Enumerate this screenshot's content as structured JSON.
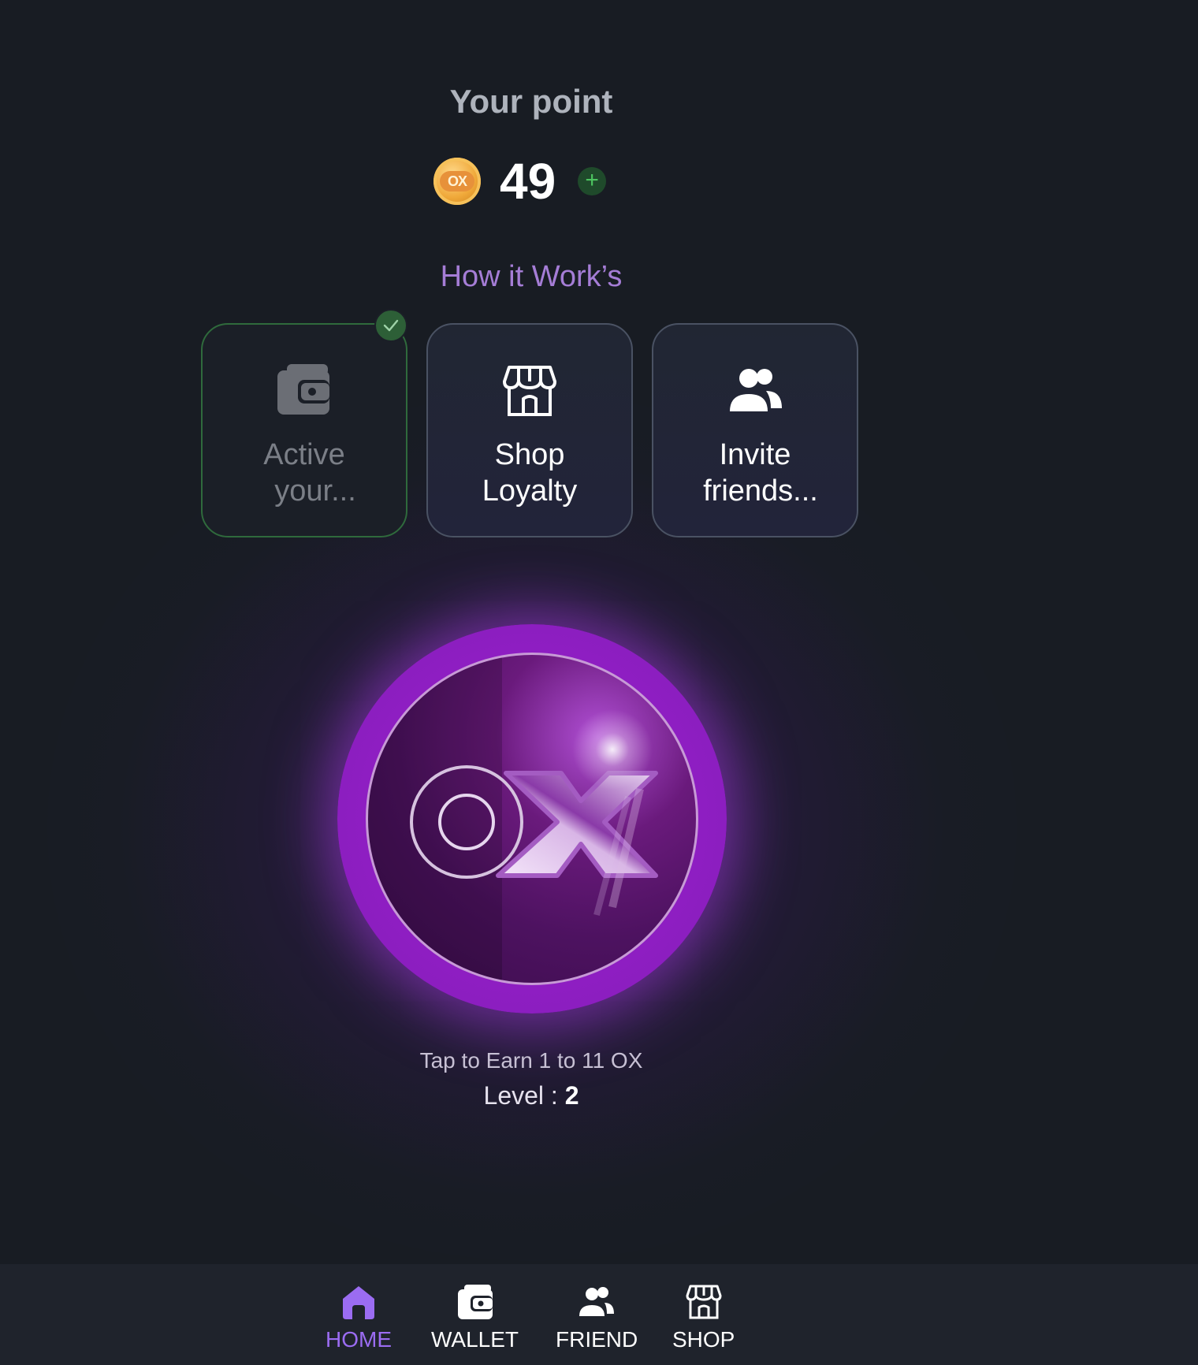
{
  "header": {
    "title": "Your point",
    "points": "49",
    "coin_label": "OX",
    "add_icon": "plus-icon"
  },
  "how_it_works": {
    "title": "How it Work’s",
    "cards": [
      {
        "label": "Active your...",
        "line1": "Active",
        "line2": "your...",
        "icon": "wallet-icon",
        "completed": true
      },
      {
        "label": "Shop Loyalty",
        "line1": "Shop",
        "line2": "Loyalty",
        "icon": "shop-icon",
        "completed": false
      },
      {
        "label": "Invite friends...",
        "line1": "Invite",
        "line2": "friends...",
        "icon": "friends-icon",
        "completed": false
      }
    ]
  },
  "tap": {
    "logo_text": "OX",
    "earn_text": "Tap to Earn 1 to 11 OX",
    "level_label": "Level : ",
    "level_value": "2"
  },
  "nav": {
    "items": [
      {
        "label": "HOME",
        "icon": "home-icon",
        "active": true
      },
      {
        "label": "WALLET",
        "icon": "wallet-icon",
        "active": false
      },
      {
        "label": "FRIEND",
        "icon": "friends-icon",
        "active": false
      },
      {
        "label": "SHOP",
        "icon": "shop-icon",
        "active": false
      }
    ]
  },
  "colors": {
    "background": "#181c23",
    "accent_purple": "#9b6cf2",
    "how_title": "#a57dd6",
    "success_green": "#2d5f37",
    "coin_purple": "#9c1fd0"
  }
}
